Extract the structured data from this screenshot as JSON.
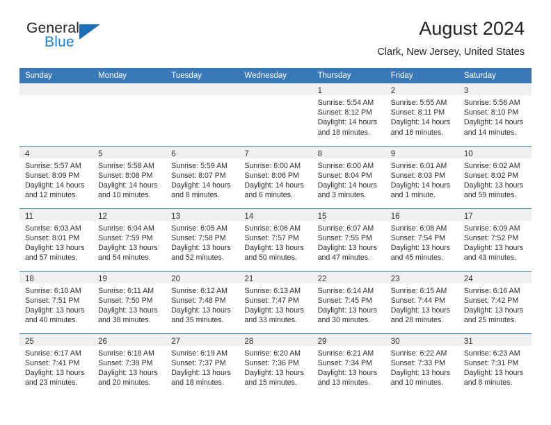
{
  "brand": {
    "name_top": "General",
    "name_bottom": "Blue",
    "triangle_color": "#1f6fb8",
    "blue_text_color": "#1b7fd4"
  },
  "header": {
    "title": "August 2024",
    "subtitle": "Clark, New Jersey, United States"
  },
  "theme": {
    "header_bar": "#3a79b8",
    "daynum_band": "#f0f0f0",
    "row_divider": "#3a79b8",
    "text": "#2b2b2b"
  },
  "weekdays": [
    "Sunday",
    "Monday",
    "Tuesday",
    "Wednesday",
    "Thursday",
    "Friday",
    "Saturday"
  ],
  "weeks": [
    [
      {
        "day": "",
        "sunrise": "",
        "sunset": "",
        "daylight1": "",
        "daylight2": ""
      },
      {
        "day": "",
        "sunrise": "",
        "sunset": "",
        "daylight1": "",
        "daylight2": ""
      },
      {
        "day": "",
        "sunrise": "",
        "sunset": "",
        "daylight1": "",
        "daylight2": ""
      },
      {
        "day": "",
        "sunrise": "",
        "sunset": "",
        "daylight1": "",
        "daylight2": ""
      },
      {
        "day": "1",
        "sunrise": "Sunrise: 5:54 AM",
        "sunset": "Sunset: 8:12 PM",
        "daylight1": "Daylight: 14 hours",
        "daylight2": "and 18 minutes."
      },
      {
        "day": "2",
        "sunrise": "Sunrise: 5:55 AM",
        "sunset": "Sunset: 8:11 PM",
        "daylight1": "Daylight: 14 hours",
        "daylight2": "and 16 minutes."
      },
      {
        "day": "3",
        "sunrise": "Sunrise: 5:56 AM",
        "sunset": "Sunset: 8:10 PM",
        "daylight1": "Daylight: 14 hours",
        "daylight2": "and 14 minutes."
      }
    ],
    [
      {
        "day": "4",
        "sunrise": "Sunrise: 5:57 AM",
        "sunset": "Sunset: 8:09 PM",
        "daylight1": "Daylight: 14 hours",
        "daylight2": "and 12 minutes."
      },
      {
        "day": "5",
        "sunrise": "Sunrise: 5:58 AM",
        "sunset": "Sunset: 8:08 PM",
        "daylight1": "Daylight: 14 hours",
        "daylight2": "and 10 minutes."
      },
      {
        "day": "6",
        "sunrise": "Sunrise: 5:59 AM",
        "sunset": "Sunset: 8:07 PM",
        "daylight1": "Daylight: 14 hours",
        "daylight2": "and 8 minutes."
      },
      {
        "day": "7",
        "sunrise": "Sunrise: 6:00 AM",
        "sunset": "Sunset: 8:06 PM",
        "daylight1": "Daylight: 14 hours",
        "daylight2": "and 6 minutes."
      },
      {
        "day": "8",
        "sunrise": "Sunrise: 6:00 AM",
        "sunset": "Sunset: 8:04 PM",
        "daylight1": "Daylight: 14 hours",
        "daylight2": "and 3 minutes."
      },
      {
        "day": "9",
        "sunrise": "Sunrise: 6:01 AM",
        "sunset": "Sunset: 8:03 PM",
        "daylight1": "Daylight: 14 hours",
        "daylight2": "and 1 minute."
      },
      {
        "day": "10",
        "sunrise": "Sunrise: 6:02 AM",
        "sunset": "Sunset: 8:02 PM",
        "daylight1": "Daylight: 13 hours",
        "daylight2": "and 59 minutes."
      }
    ],
    [
      {
        "day": "11",
        "sunrise": "Sunrise: 6:03 AM",
        "sunset": "Sunset: 8:01 PM",
        "daylight1": "Daylight: 13 hours",
        "daylight2": "and 57 minutes."
      },
      {
        "day": "12",
        "sunrise": "Sunrise: 6:04 AM",
        "sunset": "Sunset: 7:59 PM",
        "daylight1": "Daylight: 13 hours",
        "daylight2": "and 54 minutes."
      },
      {
        "day": "13",
        "sunrise": "Sunrise: 6:05 AM",
        "sunset": "Sunset: 7:58 PM",
        "daylight1": "Daylight: 13 hours",
        "daylight2": "and 52 minutes."
      },
      {
        "day": "14",
        "sunrise": "Sunrise: 6:06 AM",
        "sunset": "Sunset: 7:57 PM",
        "daylight1": "Daylight: 13 hours",
        "daylight2": "and 50 minutes."
      },
      {
        "day": "15",
        "sunrise": "Sunrise: 6:07 AM",
        "sunset": "Sunset: 7:55 PM",
        "daylight1": "Daylight: 13 hours",
        "daylight2": "and 47 minutes."
      },
      {
        "day": "16",
        "sunrise": "Sunrise: 6:08 AM",
        "sunset": "Sunset: 7:54 PM",
        "daylight1": "Daylight: 13 hours",
        "daylight2": "and 45 minutes."
      },
      {
        "day": "17",
        "sunrise": "Sunrise: 6:09 AM",
        "sunset": "Sunset: 7:52 PM",
        "daylight1": "Daylight: 13 hours",
        "daylight2": "and 43 minutes."
      }
    ],
    [
      {
        "day": "18",
        "sunrise": "Sunrise: 6:10 AM",
        "sunset": "Sunset: 7:51 PM",
        "daylight1": "Daylight: 13 hours",
        "daylight2": "and 40 minutes."
      },
      {
        "day": "19",
        "sunrise": "Sunrise: 6:11 AM",
        "sunset": "Sunset: 7:50 PM",
        "daylight1": "Daylight: 13 hours",
        "daylight2": "and 38 minutes."
      },
      {
        "day": "20",
        "sunrise": "Sunrise: 6:12 AM",
        "sunset": "Sunset: 7:48 PM",
        "daylight1": "Daylight: 13 hours",
        "daylight2": "and 35 minutes."
      },
      {
        "day": "21",
        "sunrise": "Sunrise: 6:13 AM",
        "sunset": "Sunset: 7:47 PM",
        "daylight1": "Daylight: 13 hours",
        "daylight2": "and 33 minutes."
      },
      {
        "day": "22",
        "sunrise": "Sunrise: 6:14 AM",
        "sunset": "Sunset: 7:45 PM",
        "daylight1": "Daylight: 13 hours",
        "daylight2": "and 30 minutes."
      },
      {
        "day": "23",
        "sunrise": "Sunrise: 6:15 AM",
        "sunset": "Sunset: 7:44 PM",
        "daylight1": "Daylight: 13 hours",
        "daylight2": "and 28 minutes."
      },
      {
        "day": "24",
        "sunrise": "Sunrise: 6:16 AM",
        "sunset": "Sunset: 7:42 PM",
        "daylight1": "Daylight: 13 hours",
        "daylight2": "and 25 minutes."
      }
    ],
    [
      {
        "day": "25",
        "sunrise": "Sunrise: 6:17 AM",
        "sunset": "Sunset: 7:41 PM",
        "daylight1": "Daylight: 13 hours",
        "daylight2": "and 23 minutes."
      },
      {
        "day": "26",
        "sunrise": "Sunrise: 6:18 AM",
        "sunset": "Sunset: 7:39 PM",
        "daylight1": "Daylight: 13 hours",
        "daylight2": "and 20 minutes."
      },
      {
        "day": "27",
        "sunrise": "Sunrise: 6:19 AM",
        "sunset": "Sunset: 7:37 PM",
        "daylight1": "Daylight: 13 hours",
        "daylight2": "and 18 minutes."
      },
      {
        "day": "28",
        "sunrise": "Sunrise: 6:20 AM",
        "sunset": "Sunset: 7:36 PM",
        "daylight1": "Daylight: 13 hours",
        "daylight2": "and 15 minutes."
      },
      {
        "day": "29",
        "sunrise": "Sunrise: 6:21 AM",
        "sunset": "Sunset: 7:34 PM",
        "daylight1": "Daylight: 13 hours",
        "daylight2": "and 13 minutes."
      },
      {
        "day": "30",
        "sunrise": "Sunrise: 6:22 AM",
        "sunset": "Sunset: 7:33 PM",
        "daylight1": "Daylight: 13 hours",
        "daylight2": "and 10 minutes."
      },
      {
        "day": "31",
        "sunrise": "Sunrise: 6:23 AM",
        "sunset": "Sunset: 7:31 PM",
        "daylight1": "Daylight: 13 hours",
        "daylight2": "and 8 minutes."
      }
    ]
  ]
}
